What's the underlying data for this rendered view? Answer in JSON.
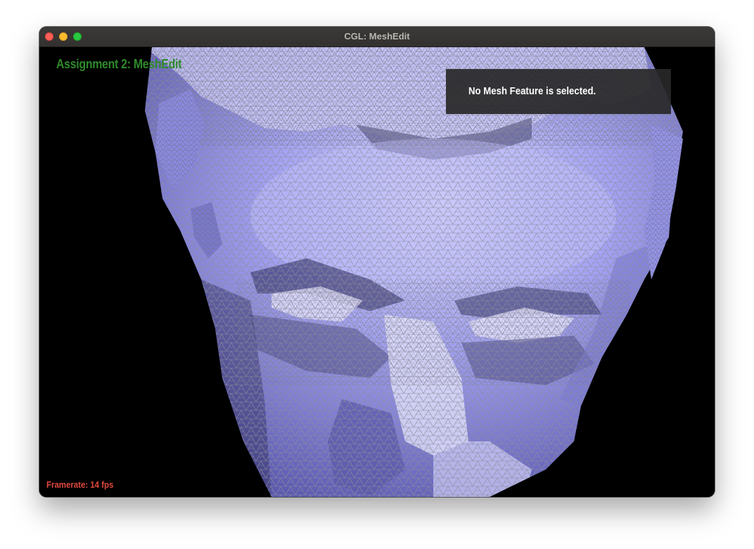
{
  "window": {
    "title": "CGL: MeshEdit"
  },
  "hud": {
    "app_title": "Assignment 2: MeshEdit",
    "selection_message": "No Mesh Feature is selected.",
    "framerate_label": "Framerate: 14 fps"
  },
  "viewport": {
    "content": "wireframe-shaded-mesh",
    "mesh_fill_color": "#9d9cf2",
    "mesh_edge_color": "#8a8a99",
    "background_color": "#000000"
  },
  "colors": {
    "title_green": "#2e8a2a",
    "framerate_red": "#e0483e",
    "panel_bg": "#282828"
  }
}
